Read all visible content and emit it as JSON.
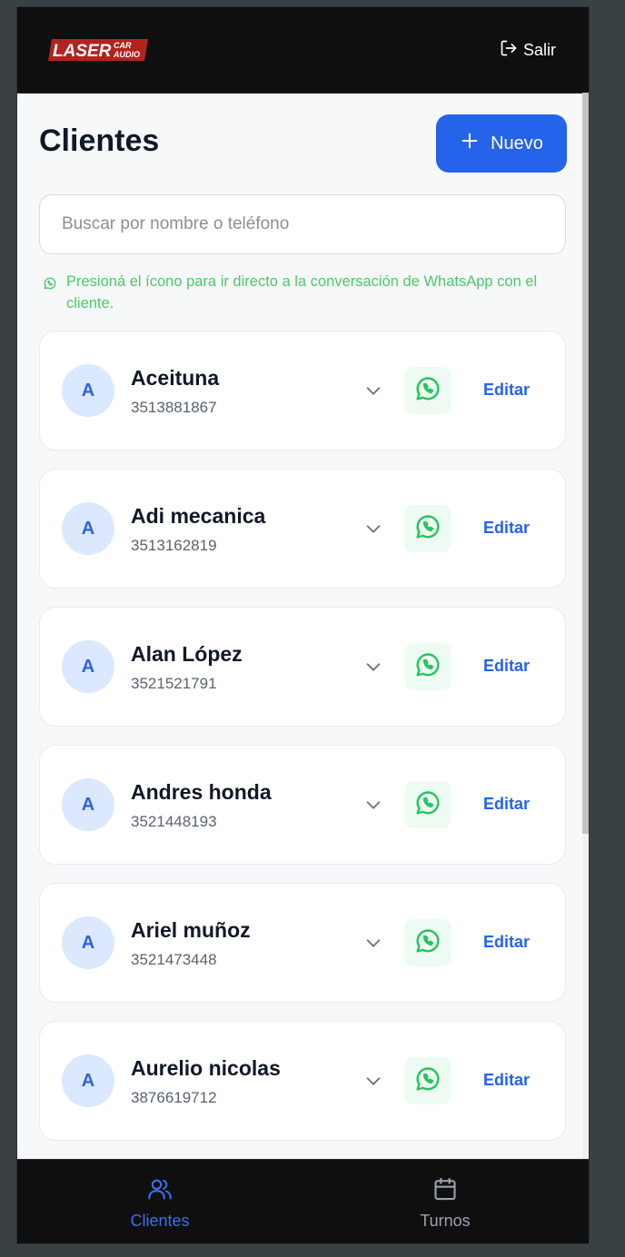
{
  "header": {
    "logo": {
      "main": "LASER",
      "sub_top": "CAR",
      "sub_bottom": "AUDIO"
    },
    "logout_label": "Salir"
  },
  "page": {
    "title": "Clientes",
    "new_button_label": "Nuevo"
  },
  "search": {
    "placeholder": "Buscar por nombre o teléfono",
    "value": ""
  },
  "hint": {
    "text": "Presioná el ícono para ir directo a la conversación de WhatsApp con el cliente."
  },
  "clients": [
    {
      "initial": "A",
      "name": "Aceituna",
      "phone": "3513881867",
      "edit_label": "Editar"
    },
    {
      "initial": "A",
      "name": "Adi mecanica",
      "phone": "3513162819",
      "edit_label": "Editar"
    },
    {
      "initial": "A",
      "name": "Alan López",
      "phone": "3521521791",
      "edit_label": "Editar"
    },
    {
      "initial": "A",
      "name": "Andres honda",
      "phone": "3521448193",
      "edit_label": "Editar"
    },
    {
      "initial": "A",
      "name": "Ariel muñoz",
      "phone": "3521473448",
      "edit_label": "Editar"
    },
    {
      "initial": "A",
      "name": "Aurelio nicolas",
      "phone": "3876619712",
      "edit_label": "Editar"
    }
  ],
  "bottom_nav": {
    "items": [
      {
        "label": "Clientes",
        "icon": "users-icon",
        "active": true
      },
      {
        "label": "Turnos",
        "icon": "calendar-icon",
        "active": false
      }
    ]
  },
  "colors": {
    "accent": "#2563eb",
    "whatsapp": "#25d366",
    "avatar_bg": "#dbe8fd",
    "header_bg": "#0f0f10"
  }
}
